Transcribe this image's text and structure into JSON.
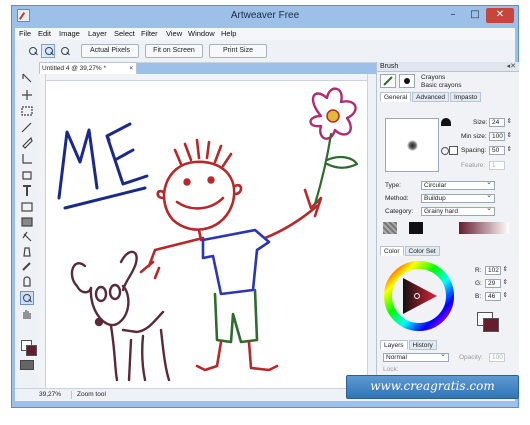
{
  "window": {
    "title": "Artweaver Free"
  },
  "menu": [
    "File",
    "Edit",
    "Image",
    "Layer",
    "Select",
    "Filter",
    "View",
    "Window",
    "Help"
  ],
  "toolbar": {
    "actual_pixels": "Actual Pixels",
    "fit_on_screen": "Fit on Screen",
    "print_size": "Print Size"
  },
  "document": {
    "tab_title": "Untitled 4 @ 39,27% *",
    "drawing_text": "ME"
  },
  "status": {
    "zoom": "39,27%",
    "tool": "Zoom tool"
  },
  "brush_panel": {
    "title": "Brush",
    "category_name": "Crayons",
    "variant_name": "Basic crayons",
    "tabs": [
      "General",
      "Advanced",
      "Impasto"
    ],
    "size_label": "Size:",
    "size_value": "24",
    "min_size_label": "Min size:",
    "min_size_value": "100",
    "spacing_label": "Spacing:",
    "spacing_value": "50",
    "feature_label": "Feature:",
    "feature_value": "1",
    "type_label": "Type:",
    "type_value": "Circular",
    "method_label": "Method:",
    "method_value": "Buildup",
    "category_label": "Category:",
    "category_value": "Grainy hard"
  },
  "color_panel": {
    "tabs": [
      "Color",
      "Color Set"
    ],
    "r_label": "R:",
    "r_value": "102",
    "g_label": "G:",
    "g_value": "29",
    "b_label": "B:",
    "b_value": "46",
    "current_color": "#661d2e"
  },
  "layers_panel": {
    "tabs": [
      "Layers",
      "History"
    ],
    "blend_mode": "Normal",
    "opacity_label": "Opacity:",
    "opacity_value": "100",
    "lock_label": "Lock:"
  },
  "watermark": "www.creagratis.com",
  "colors": {
    "foreground": "#661d2e",
    "background": "#ffffff",
    "accent": "#3274b6"
  }
}
